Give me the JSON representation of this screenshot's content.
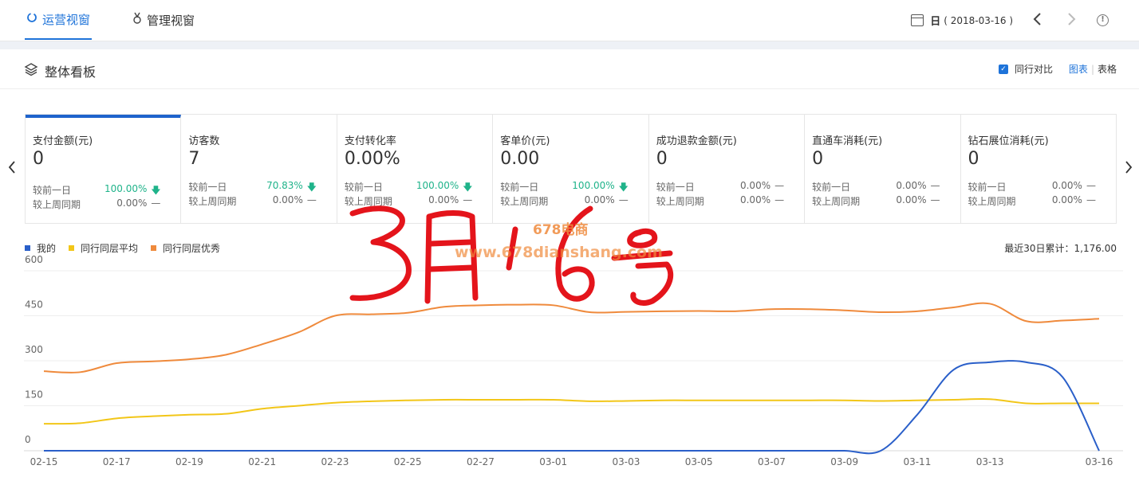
{
  "tabs": [
    {
      "label": "运营视窗",
      "active": true
    },
    {
      "label": "管理视窗",
      "active": false
    }
  ],
  "date": {
    "unit": "日",
    "value": "( 2018-03-16 )"
  },
  "panel": {
    "title": "整体看板",
    "compare_label": "同行对比",
    "view_chart": "图表",
    "view_table": "表格"
  },
  "metrics": [
    {
      "label": "支付金额(元)",
      "value": "0",
      "day_label": "较前一日",
      "day_pct": "100.00%",
      "day_dir": "down",
      "week_label": "较上周同期",
      "week_pct": "0.00%",
      "week_dir": "flat"
    },
    {
      "label": "访客数",
      "value": "7",
      "day_label": "较前一日",
      "day_pct": "70.83%",
      "day_dir": "down",
      "week_label": "较上周同期",
      "week_pct": "0.00%",
      "week_dir": "flat"
    },
    {
      "label": "支付转化率",
      "value": "0.00%",
      "day_label": "较前一日",
      "day_pct": "100.00%",
      "day_dir": "down",
      "week_label": "较上周同期",
      "week_pct": "0.00%",
      "week_dir": "flat"
    },
    {
      "label": "客单价(元)",
      "value": "0.00",
      "day_label": "较前一日",
      "day_pct": "100.00%",
      "day_dir": "down",
      "week_label": "较上周同期",
      "week_pct": "0.00%",
      "week_dir": "flat"
    },
    {
      "label": "成功退款金额(元)",
      "value": "0",
      "day_label": "较前一日",
      "day_pct": "0.00%",
      "day_dir": "flat",
      "week_label": "较上周同期",
      "week_pct": "0.00%",
      "week_dir": "flat"
    },
    {
      "label": "直通车消耗(元)",
      "value": "0",
      "day_label": "较前一日",
      "day_pct": "0.00%",
      "day_dir": "flat",
      "week_label": "较上周同期",
      "week_pct": "0.00%",
      "week_dir": "flat"
    },
    {
      "label": "钻石展位消耗(元)",
      "value": "0",
      "day_label": "较前一日",
      "day_pct": "0.00%",
      "day_dir": "flat",
      "week_label": "较上周同期",
      "week_pct": "0.00%",
      "week_dir": "flat"
    }
  ],
  "legend_items": [
    {
      "name": "我的",
      "color": "#2a5fc9"
    },
    {
      "name": "同行同层平均",
      "color": "#f2c618"
    },
    {
      "name": "同行同层优秀",
      "color": "#ef8a3c"
    }
  ],
  "summary_text": "最近30日累计：1,176.00",
  "watermark": {
    "line1": "678电商",
    "line2": "www.678dianshang.com",
    "handwriting": "3月16号"
  },
  "chart_data": {
    "type": "line",
    "x": [
      "02-15",
      "02-16",
      "02-17",
      "02-18",
      "02-19",
      "02-20",
      "02-21",
      "02-22",
      "02-23",
      "02-24",
      "02-25",
      "02-26",
      "02-27",
      "02-28",
      "03-01",
      "03-02",
      "03-03",
      "03-04",
      "03-05",
      "03-06",
      "03-07",
      "03-08",
      "03-09",
      "03-10",
      "03-11",
      "03-12",
      "03-13",
      "03-14",
      "03-15",
      "03-16"
    ],
    "xticks": [
      "02-15",
      "02-17",
      "02-19",
      "02-21",
      "02-23",
      "02-25",
      "02-27",
      "03-01",
      "03-03",
      "03-05",
      "03-07",
      "03-09",
      "03-11",
      "03-13",
      "03-16"
    ],
    "yticks": [
      0,
      150,
      300,
      450,
      600
    ],
    "ylim": [
      0,
      600
    ],
    "grid": true,
    "legend_position": "top-left",
    "series": [
      {
        "name": "我的",
        "color": "#2a5fc9",
        "values": [
          0,
          0,
          0,
          0,
          0,
          0,
          0,
          0,
          0,
          0,
          0,
          0,
          0,
          0,
          0,
          0,
          0,
          0,
          0,
          0,
          0,
          0,
          0,
          0,
          120,
          270,
          295,
          295,
          245,
          0
        ]
      },
      {
        "name": "同行同层平均",
        "color": "#f2c618",
        "values": [
          90,
          92,
          108,
          115,
          120,
          123,
          140,
          150,
          160,
          165,
          168,
          170,
          170,
          170,
          170,
          165,
          166,
          168,
          168,
          168,
          168,
          168,
          168,
          166,
          168,
          170,
          172,
          158,
          158,
          158
        ]
      },
      {
        "name": "同行同层优秀",
        "color": "#ef8a3c",
        "values": [
          265,
          262,
          292,
          298,
          305,
          320,
          355,
          395,
          450,
          455,
          460,
          480,
          485,
          487,
          485,
          462,
          463,
          465,
          466,
          465,
          472,
          472,
          468,
          462,
          465,
          478,
          490,
          432,
          434,
          440
        ]
      }
    ]
  }
}
